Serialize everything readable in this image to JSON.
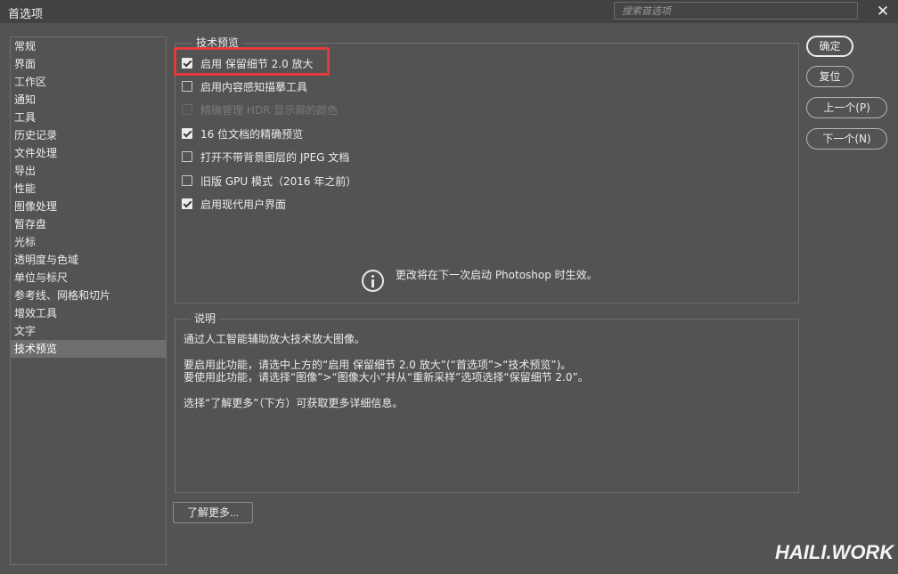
{
  "window": {
    "title": "首选项",
    "search_placeholder": "搜索首选项",
    "close_label": "✕"
  },
  "sidebar": {
    "items": [
      {
        "label": "常规"
      },
      {
        "label": "界面"
      },
      {
        "label": "工作区"
      },
      {
        "label": "通知"
      },
      {
        "label": "工具"
      },
      {
        "label": "历史记录"
      },
      {
        "label": "文件处理"
      },
      {
        "label": "导出"
      },
      {
        "label": "性能"
      },
      {
        "label": "图像处理"
      },
      {
        "label": "暂存盘"
      },
      {
        "label": "光标"
      },
      {
        "label": "透明度与色域"
      },
      {
        "label": "单位与标尺"
      },
      {
        "label": "参考线、网格和切片"
      },
      {
        "label": "增效工具"
      },
      {
        "label": "文字"
      },
      {
        "label": "技术预览"
      }
    ],
    "selected_index": 17
  },
  "tech_preview": {
    "group_label": "技术预览",
    "options": [
      {
        "label": "启用 保留细节 2.0 放大",
        "checked": true,
        "disabled": false
      },
      {
        "label": "启用内容感知描摹工具",
        "checked": false,
        "disabled": false
      },
      {
        "label": "精确管理 HDR 显示屏的颜色",
        "checked": false,
        "disabled": true
      },
      {
        "label": "16 位文档的精确预览",
        "checked": true,
        "disabled": false
      },
      {
        "label": "打开不带背景图层的 JPEG 文档",
        "checked": false,
        "disabled": false
      },
      {
        "label": "旧版 GPU 模式（2016 年之前）",
        "checked": false,
        "disabled": false
      },
      {
        "label": "启用现代用户界面",
        "checked": true,
        "disabled": false
      }
    ],
    "info_text": "更改将在下一次启动 Photoshop 时生效。"
  },
  "description": {
    "group_label": "说明",
    "lines": [
      "通过人工智能辅助放大技术放大图像。",
      "要启用此功能，请选中上方的“启用 保留细节 2.0 放大”(“首选项”>“技术预览”)。",
      "要使用此功能，请选择“图像”>“图像大小”并从“重新采样”选项选择“保留细节 2.0”。",
      "选择“了解更多”（下方）可获取更多详细信息。"
    ]
  },
  "buttons": {
    "ok": "确定",
    "reset": "复位",
    "prev": "上一个(P)",
    "next": "下一个(N)",
    "learn_more": "了解更多..."
  },
  "watermark": "HAILI.WORK",
  "colors": {
    "background": "#535353",
    "titlebar": "#424242",
    "highlight": "#e5393c",
    "selected_item": "#6e6e6e"
  }
}
